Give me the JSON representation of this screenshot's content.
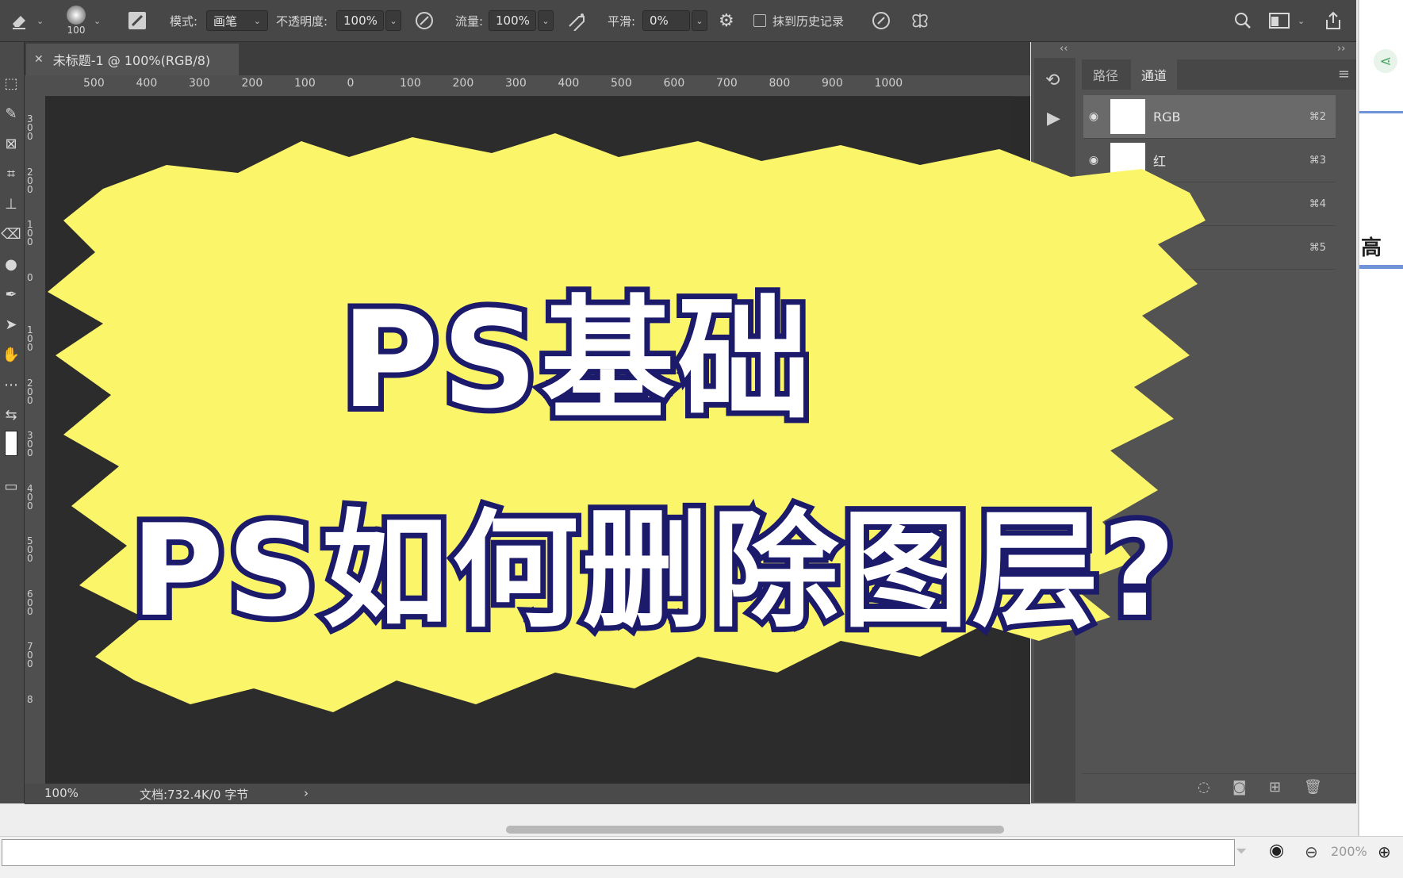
{
  "options_bar": {
    "brush_size": "100",
    "mode_label": "模式:",
    "mode_value": "画笔",
    "opacity_label": "不透明度:",
    "opacity_value": "100%",
    "flow_label": "流量:",
    "flow_value": "100%",
    "smoothing_label": "平滑:",
    "smoothing_value": "0%",
    "erase_history_label": "抹到历史记录"
  },
  "document": {
    "tab_title": "未标题-1 @ 100%(RGB/8)",
    "h_ruler": [
      "500",
      "400",
      "300",
      "200",
      "100",
      "0",
      "100",
      "200",
      "300",
      "400",
      "500",
      "600",
      "700",
      "800",
      "900",
      "1000"
    ],
    "v_ruler": [
      "3 0 0",
      "2 0 0",
      "1 0 0",
      "0",
      "1 0 0",
      "2 0 0",
      "3 0 0",
      "4 0 0",
      "5 0 0",
      "6 0 0",
      "7 0 0",
      "8"
    ],
    "zoom": "100%",
    "doc_info": "文档:732.4K/0 字节"
  },
  "channels_panel": {
    "tabs": [
      "路径",
      "通道"
    ],
    "rows": [
      {
        "name": "RGB",
        "shortcut": "⌘2"
      },
      {
        "name": "红",
        "shortcut": "⌘3"
      },
      {
        "name": "",
        "shortcut": "⌘4"
      },
      {
        "name": "",
        "shortcut": "⌘5"
      }
    ]
  },
  "right_app": {
    "partial_text": "高"
  },
  "bottom_bar": {
    "zoom": "200%"
  },
  "overlay": {
    "line1": "PS基础",
    "line2": "PS如何删除图层?"
  },
  "colors": {
    "brush_yellow": "#fbf56a",
    "title_stroke": "#1c1a6a",
    "ui_dark": "#474747",
    "canvas": "#2c2c2c"
  }
}
